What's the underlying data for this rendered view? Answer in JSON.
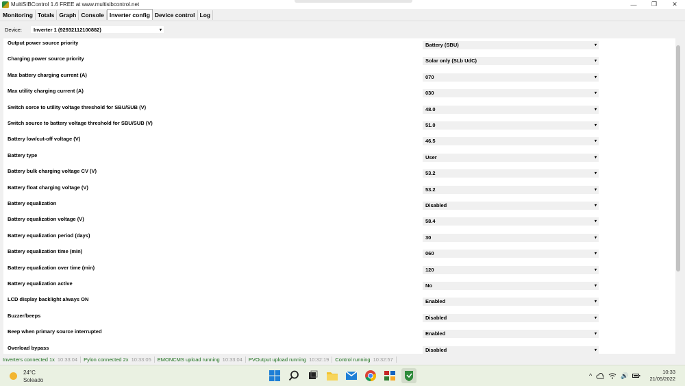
{
  "window": {
    "title": "MultiSIBControl 1.6 FREE at www.multisibcontrol.net",
    "minimize_glyph": "—",
    "maximize_glyph": "❐",
    "close_glyph": "✕"
  },
  "tabs": [
    {
      "label": "Monitoring"
    },
    {
      "label": "Totals"
    },
    {
      "label": "Graph"
    },
    {
      "label": "Console"
    },
    {
      "label": "Inverter config"
    },
    {
      "label": "Device control"
    },
    {
      "label": "Log"
    }
  ],
  "active_tab": "Inverter config",
  "device": {
    "label": "Device:",
    "value": "Inverter 1 (92932112100882)"
  },
  "settings": [
    {
      "label": "Output power source priority",
      "value": "Battery (SBU)"
    },
    {
      "label": "Charging power source priority",
      "value": "Solar only (SLb UdC)"
    },
    {
      "label": "Max battery charging current (A)",
      "value": "070"
    },
    {
      "label": "Max utility charging current (A)",
      "value": "030"
    },
    {
      "label": "Switch sorce to utility voltage threshold for SBU/SUB (V)",
      "value": "48.0"
    },
    {
      "label": "Switch source to battery voltage threshold for SBU/SUB (V)",
      "value": "51.0"
    },
    {
      "label": "Battery low/cut-off voltage (V)",
      "value": "46.5"
    },
    {
      "label": "Battery type",
      "value": "User"
    },
    {
      "label": "Battery bulk charging voltage CV (V)",
      "value": "53.2"
    },
    {
      "label": "Battery float charging voltage (V)",
      "value": "53.2"
    },
    {
      "label": "Battery equalization",
      "value": "Disabled"
    },
    {
      "label": "Battery equalization voltage (V)",
      "value": "58.4"
    },
    {
      "label": "Battery equalization period (days)",
      "value": "30"
    },
    {
      "label": "Battery equalization time (min)",
      "value": "060"
    },
    {
      "label": "Battery equalization over time (min)",
      "value": "120"
    },
    {
      "label": "Battery equalization active",
      "value": "No"
    },
    {
      "label": "LCD display backlight always ON",
      "value": "Enabled"
    },
    {
      "label": "Buzzer/beeps",
      "value": "Disabled"
    },
    {
      "label": "Beep when primary source interrupted",
      "value": "Enabled"
    },
    {
      "label": "Overload bypass",
      "value": "Disabled"
    }
  ],
  "dropdown_arrow": "▾",
  "status": [
    {
      "text": "Inverters connected 1x",
      "time": "10:33:04"
    },
    {
      "text": "Pylon connected 2x",
      "time": "10:33:05"
    },
    {
      "text": "EMONCMS upload running",
      "time": "10:33:04"
    },
    {
      "text": "PVOutput upload running",
      "time": "10:32:19"
    },
    {
      "text": "Control running",
      "time": "10:32:57"
    }
  ],
  "status_colors": {
    "ok": "#1a6e1a",
    "time": "#9a9a9a"
  },
  "taskbar": {
    "weather_temp": "24°C",
    "weather_desc": "Soleado",
    "clock_time": "10:33",
    "clock_date": "21/05/2022",
    "apps": [
      "windows-start-icon",
      "search-icon",
      "task-view-icon",
      "file-explorer-icon",
      "mail-icon",
      "chrome-icon",
      "app-grid-icon",
      "multisib-app-icon"
    ],
    "tray_chevron": "^",
    "tray_volume": "🔊"
  }
}
